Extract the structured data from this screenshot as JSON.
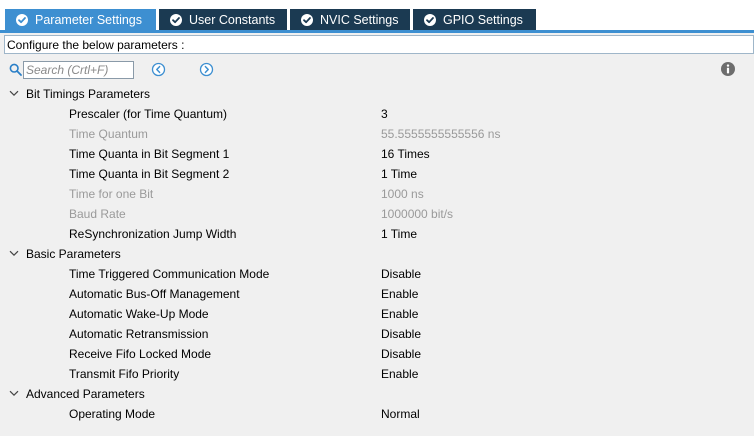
{
  "tabs": [
    {
      "label": "Parameter Settings",
      "active": true
    },
    {
      "label": "User Constants",
      "active": false
    },
    {
      "label": "NVIC Settings",
      "active": false
    },
    {
      "label": "GPIO Settings",
      "active": false
    }
  ],
  "config_header": "Configure the below parameters :",
  "search": {
    "placeholder": "Search (Crtl+F)",
    "value": ""
  },
  "groups": [
    {
      "label": "Bit Timings Parameters",
      "items": [
        {
          "label": "Prescaler (for Time Quantum)",
          "value": "3",
          "enabled": true
        },
        {
          "label": "Time Quantum",
          "value": "55.5555555555556 ns",
          "enabled": false
        },
        {
          "label": "Time Quanta in Bit Segment 1",
          "value": "16 Times",
          "enabled": true
        },
        {
          "label": "Time Quanta in Bit Segment 2",
          "value": "1 Time",
          "enabled": true
        },
        {
          "label": "Time for one Bit",
          "value": "1000 ns",
          "enabled": false
        },
        {
          "label": "Baud Rate",
          "value": "1000000 bit/s",
          "enabled": false
        },
        {
          "label": "ReSynchronization Jump Width",
          "value": "1 Time",
          "enabled": true
        }
      ]
    },
    {
      "label": "Basic Parameters",
      "items": [
        {
          "label": "Time Triggered Communication Mode",
          "value": "Disable",
          "enabled": true
        },
        {
          "label": "Automatic Bus-Off Management",
          "value": "Enable",
          "enabled": true
        },
        {
          "label": "Automatic Wake-Up Mode",
          "value": "Enable",
          "enabled": true
        },
        {
          "label": "Automatic Retransmission",
          "value": "Disable",
          "enabled": true
        },
        {
          "label": "Receive Fifo Locked Mode",
          "value": "Disable",
          "enabled": true
        },
        {
          "label": "Transmit Fifo Priority",
          "value": "Enable",
          "enabled": true
        }
      ]
    },
    {
      "label": "Advanced Parameters",
      "items": [
        {
          "label": "Operating Mode",
          "value": "Normal",
          "enabled": true
        }
      ]
    }
  ],
  "icons": {
    "tab_check": "check-circle-icon",
    "search": "search-icon",
    "prev": "arrow-left-circle-icon",
    "next": "arrow-right-circle-icon",
    "info": "info-icon",
    "group_toggle": "chevron-down-icon"
  },
  "colors": {
    "tab_active": "#3d8fd1",
    "tab_inactive": "#1b3a52",
    "text_disabled": "#9a9a9a",
    "nav_button": "#3d8fd1"
  }
}
